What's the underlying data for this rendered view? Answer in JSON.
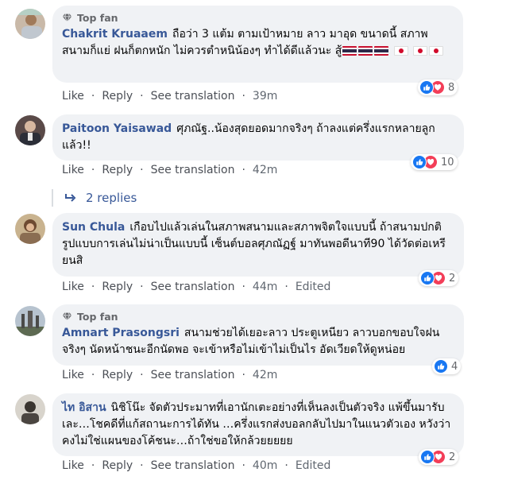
{
  "labels": {
    "like": "Like",
    "reply": "Reply",
    "see_translation": "See translation",
    "top_fan": "Top fan",
    "edited": "Edited"
  },
  "replies_label": "2 replies",
  "comments": [
    {
      "author": "Chakrit Kruaaem",
      "text": "ถือว่า 3 แต้ม ตามเป้าหมาย ลาว มาอุด ขนาดนี้ สภาพสนามก็แย่ ฝนก็ตกหนัก ไม่ควรตำหนิน้องๆ ทำได้ดีแล้วนะ สู้",
      "flags": [
        "th",
        "th",
        "th",
        "jp",
        "jp",
        "jp"
      ],
      "time": "39m",
      "reactions": 8,
      "reaction_types": [
        "like",
        "love"
      ]
    },
    {
      "author": "Paitoon Yaisawad",
      "text": "ศุภณัฐ..น้องสุดยอดมากจริงๆ ถ้าลงแต่ครึ่งแรกหลายลูกแล้ว!!",
      "time": "42m",
      "reactions": 10,
      "reaction_types": [
        "like",
        "love"
      ]
    },
    {
      "author": "Sun Chula",
      "text": "เกือบไปแล้วเล่นในสภาพสนามและสภาพจิตใจแบบนี้ ถ้าสนามปกติรูปแบบการเล่นไม่น่าเป็นแบบนี้ เซ็นต์บอลศุภณัฏฐ์ มาทันพอดีนาที90 ได้วัดต่อเหรียนสิ",
      "time": "44m",
      "edited": true,
      "reactions": 2,
      "reaction_types": [
        "like",
        "love"
      ]
    },
    {
      "author": "Amnart Prasongsri",
      "text": "สนามช่วยได้เยอะลาว ประตูเหนียว ลาวบอกขอบใจฝนจริงๆ นัดหน้าชนะอีกนัดพอ จะเข้าหรือไม่เข้าไม่เป็นไร อัดเวียดให้ดูหน่อย",
      "time": "42m",
      "reactions": 4,
      "reaction_types": [
        "like"
      ]
    },
    {
      "author": "ไท อิสาน",
      "text": "นิชิโน๊ะ จัดตัวประมาทที่เอานักเตะอย่างที่เห็นลงเป็นตัวจริง แพ้ขึ้นมารับเละ…โชคดีที่แก้สถานะการได้ทัน …ครึ่งแรกส่งบอลกลับไปมาในแนวตัวเอง หวังว่าคงไม่ใช่แผนของโค้ชนะ…ถ้าใช่ขอให้กล้วยยยยย",
      "time": "40m",
      "edited": true,
      "reactions": 2,
      "reaction_types": [
        "like",
        "love"
      ]
    }
  ],
  "colors": {
    "bubble": "#f0f2f5",
    "name": "#385898",
    "like": "#1877f2",
    "love": "#f33e58"
  }
}
